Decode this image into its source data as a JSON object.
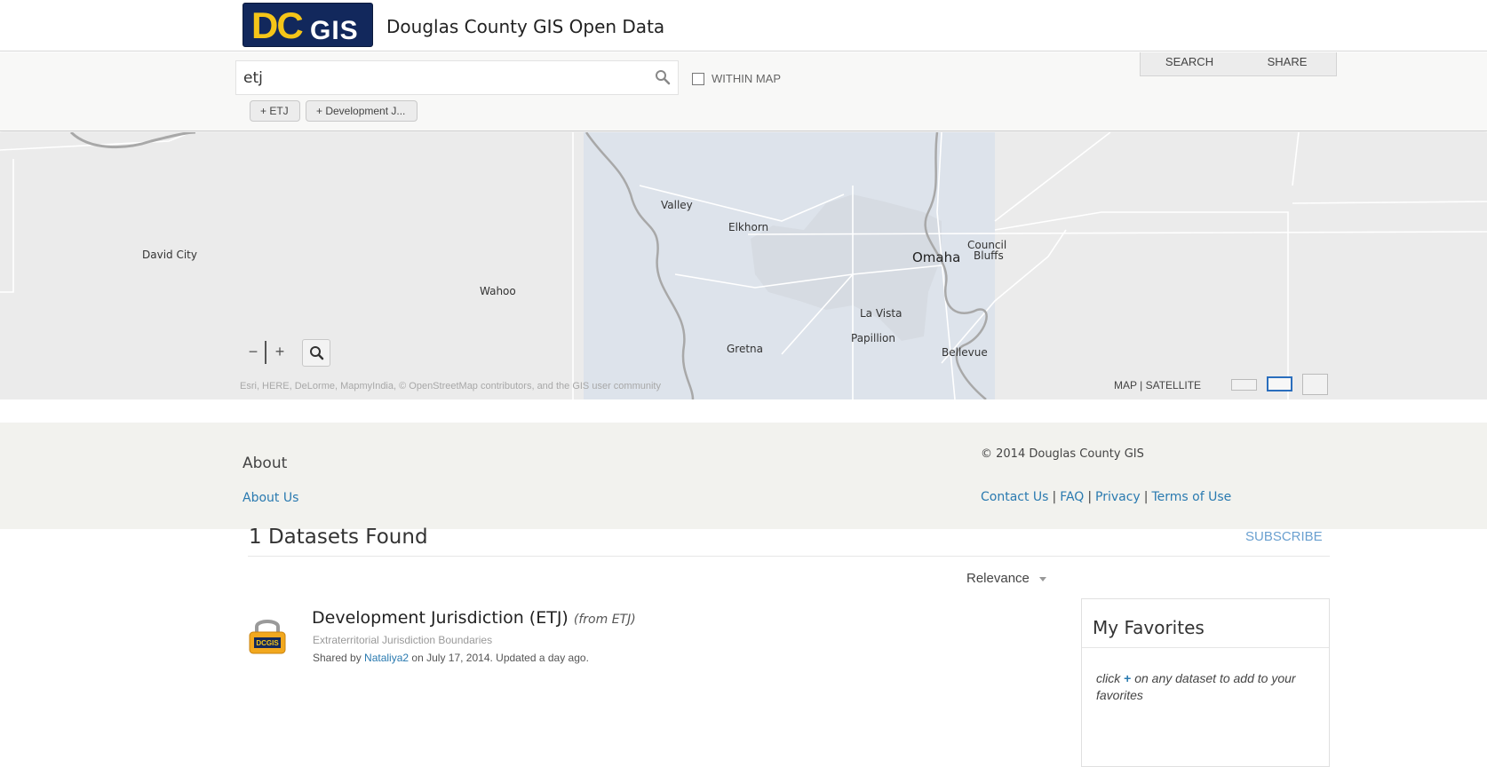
{
  "header": {
    "logo_dc": "DC",
    "logo_gis": "GIS",
    "site_title": "Douglas County GIS Open Data"
  },
  "search": {
    "value": "etj",
    "within_map_label": "WITHIN MAP",
    "tags": [
      "+ ETJ",
      "+ Development J..."
    ]
  },
  "toolbar": {
    "search_label": "SEARCH",
    "share_label": "SHARE"
  },
  "map": {
    "cities": {
      "valley": "Valley",
      "elkhorn": "Elkhorn",
      "omaha": "Omaha",
      "council": "Council",
      "bluffs": "Bluffs",
      "david_city": "David City",
      "wahoo": "Wahoo",
      "la_vista": "La Vista",
      "papillion": "Papillion",
      "gretna": "Gretna",
      "bellevue": "Bellevue"
    },
    "zoom_out": "−",
    "zoom_in": "+",
    "attribution": "Esri, HERE, DeLorme, MapmyIndia, © OpenStreetMap contributors, and the GIS user community",
    "basemap_toggle": "MAP | SATELLITE",
    "colors": {
      "background": "#ebebeb",
      "extent_highlight": "#dde3eb",
      "river": "#a8a8a8",
      "roads": "#ffffff"
    }
  },
  "footer": {
    "about_heading": "About",
    "about_link": "About Us",
    "copyright": "© 2014 Douglas County GIS",
    "links": {
      "contact": "Contact Us",
      "faq": "FAQ",
      "privacy": "Privacy",
      "terms": "Terms of Use"
    },
    "separator": "|"
  },
  "results": {
    "count_text": "1 Datasets Found",
    "subscribe": "SUBSCRIBE",
    "sort_label": "Relevance",
    "items": [
      {
        "title": "Development Jurisdiction (ETJ)",
        "from": "(from ETJ)",
        "subtitle": "Extraterritorial Jurisdiction Boundaries",
        "shared_prefix": "Shared by",
        "author": "Nataliya2",
        "shared_suffix": "on July 17, 2014. Updated a day ago.",
        "icon_text": "DCGIS"
      }
    ]
  },
  "favorites": {
    "heading": "My Favorites",
    "note_prefix": "click",
    "note_plus": "+",
    "note_suffix": "on any dataset to add to your favorites"
  },
  "colors": {
    "link": "#2a7ab0",
    "brand_navy": "#12285c",
    "brand_gold": "#f5c518"
  }
}
